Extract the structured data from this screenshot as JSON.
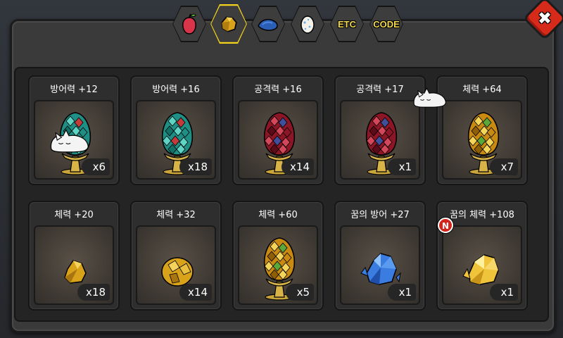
{
  "tabs": [
    {
      "name": "fruit-tab",
      "label": "",
      "icon": "red-fruit-icon",
      "active": false
    },
    {
      "name": "crystal-tab",
      "label": "",
      "icon": "gold-ore-icon",
      "active": true
    },
    {
      "name": "fish-tab",
      "label": "",
      "icon": "blue-fish-icon",
      "active": false
    },
    {
      "name": "egg-tab",
      "label": "",
      "icon": "egg-icon",
      "active": false
    },
    {
      "name": "etc-tab",
      "label": "ETC",
      "icon": "",
      "active": false
    },
    {
      "name": "code-tab",
      "label": "CODE",
      "icon": "",
      "active": false
    }
  ],
  "close_label": "✖",
  "items": [
    {
      "title": "방어력 +12",
      "count": "x6",
      "gem": "teal-egg-crystal",
      "new": false
    },
    {
      "title": "방어력 +16",
      "count": "x18",
      "gem": "teal-egg-crystal",
      "new": false
    },
    {
      "title": "공격력 +16",
      "count": "x14",
      "gem": "red-egg-crystal",
      "new": false
    },
    {
      "title": "공격력 +17",
      "count": "x1",
      "gem": "red-egg-crystal",
      "new": false
    },
    {
      "title": "체력 +64",
      "count": "x7",
      "gem": "gold-egg-crystal",
      "new": false
    },
    {
      "title": "체력 +20",
      "count": "x18",
      "gem": "gold-nugget-small",
      "new": false
    },
    {
      "title": "체력 +32",
      "count": "x14",
      "gem": "gold-nugget-round",
      "new": false
    },
    {
      "title": "체력 +60",
      "count": "x5",
      "gem": "gold-egg-crystal",
      "new": false
    },
    {
      "title": "꿈의 방어 +27",
      "count": "x1",
      "gem": "blue-crystal-cluster",
      "new": false
    },
    {
      "title": "꿈의 체력 +108",
      "count": "x1",
      "gem": "yellow-crystal-cluster",
      "new": true,
      "badge": "N"
    }
  ],
  "colors": {
    "active_tab": "#f2d21b",
    "close": "#d62a1a",
    "teal": "#2a9a8a",
    "red": "#a01c2c",
    "gold": "#d9a21b",
    "blue": "#3a7ce0"
  }
}
